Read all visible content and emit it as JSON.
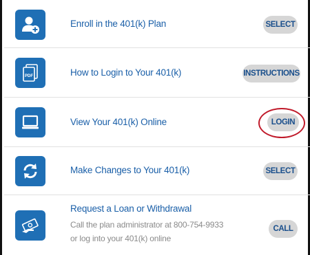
{
  "rows": [
    {
      "label": "Enroll in the 401(k) Plan",
      "button": "SELECT",
      "icon": "add-user-icon"
    },
    {
      "label": "How to Login to Your 401(k)",
      "button": "INSTRUCTIONS",
      "icon": "pdf-document-icon"
    },
    {
      "label": "View Your 401(k) Online",
      "button": "LOGIN",
      "icon": "laptop-icon"
    },
    {
      "label": "Make Changes to Your 401(k)",
      "button": "SELECT",
      "icon": "refresh-arrows-icon"
    },
    {
      "label": "Request a Loan or Withdrawal",
      "description": "Call the plan administrator at 800-754-9933 or log into your 401(k) online",
      "button": "CALL",
      "icon": "money-hand-icon"
    }
  ],
  "colors": {
    "icon_tile": "#1f6fb5",
    "label_text": "#1a5fa8",
    "button_bg": "#d6d6d6",
    "button_text": "#1a4f8c",
    "highlight_ring": "#c01a2a"
  }
}
